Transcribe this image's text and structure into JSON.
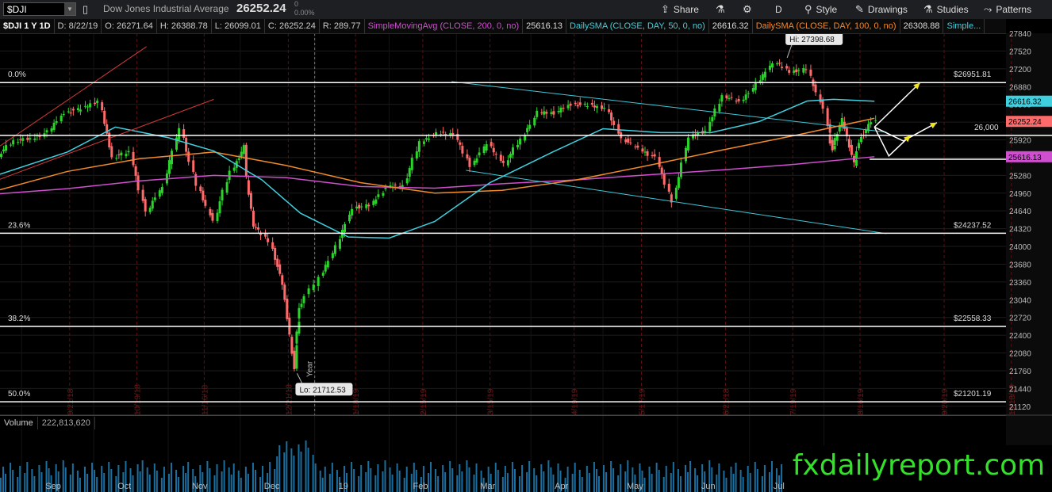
{
  "toolbar": {
    "symbol": "$DJI",
    "instrument_name": "Dow Jones Industrial Average",
    "last_price": "26252.24",
    "change": "0",
    "change_pct": "0.00%",
    "share_label": "Share",
    "interval_label": "D",
    "style_label": "Style",
    "drawings_label": "Drawings",
    "studies_label": "Studies",
    "patterns_label": "Patterns",
    "icons": [
      "flask-icon",
      "gear-icon",
      "style-icon",
      "drawings-icon",
      "studies-icon",
      "patterns-icon",
      "share-icon"
    ]
  },
  "infobar": {
    "symbol_period": "$DJI 1 Y 1D",
    "date": "D: 8/22/19",
    "open": "O: 26271.64",
    "high": "H: 26388.78",
    "low": "L: 26099.01",
    "close": "C: 26252.24",
    "range": "R: 289.77",
    "sma200_label": "SimpleMovingAvg (CLOSE, 200, 0, no)",
    "sma200_value": "25616.13",
    "sma50_label": "DailySMA (CLOSE, DAY, 50, 0, no)",
    "sma50_value": "26616.32",
    "sma100_label": "DailySMA (CLOSE, DAY, 100, 0, no)",
    "sma100_value": "26308.88",
    "more_label": "Simple..."
  },
  "volume": {
    "label": "Volume",
    "value": "222,813,620"
  },
  "watermark": "fxdailyreport.com",
  "colors": {
    "up": "#2bd42b",
    "down": "#ff6b6b",
    "sma200": "#d04fd0",
    "sma50": "#3fd0e0",
    "sma100": "#f08a2a",
    "trend_red": "#d33a3a",
    "trend_cyan": "#3fc8d8",
    "fib": "#ffffff",
    "volume": "#1b6fa0",
    "arrows": "#f2e41a"
  },
  "chart_data": {
    "type": "candlestick",
    "title": "$DJI 1 Y 1D",
    "ylim": [
      20960,
      27840
    ],
    "y_ticks": [
      21120,
      21440,
      21760,
      22080,
      22400,
      22720,
      23040,
      23360,
      23680,
      24000,
      24320,
      24640,
      24960,
      25280,
      25600,
      25920,
      26240,
      26560,
      26880,
      27200,
      27520,
      27840
    ],
    "y_tick_top_partial": "27840",
    "x_month_labels": [
      {
        "label": "Sep",
        "date": "2018-09-01"
      },
      {
        "label": "Oct",
        "date": "2018-10-01"
      },
      {
        "label": "Nov",
        "date": "2018-11-01"
      },
      {
        "label": "Dec",
        "date": "2018-12-01"
      },
      {
        "label": "19",
        "date": "2019-01-01"
      },
      {
        "label": "Feb",
        "date": "2019-02-01"
      },
      {
        "label": "Mar",
        "date": "2019-03-01"
      },
      {
        "label": "Apr",
        "date": "2019-04-01"
      },
      {
        "label": "May",
        "date": "2019-05-01"
      },
      {
        "label": "Jun",
        "date": "2019-06-01"
      },
      {
        "label": "Jul",
        "date": "2019-07-01"
      },
      {
        "label": "Au",
        "date": "2019-08-01"
      }
    ],
    "date_range": [
      "2018-08-23",
      "2019-09-20"
    ],
    "vertical_event_dates": [
      "9/21/18",
      "10/19/18",
      "11/16/18",
      "12/21/18",
      "1/18/19",
      "2/15/19",
      "3/15/19",
      "4/19/19",
      "5/17/19",
      "6/21/18",
      "7/19/19",
      "8/16/19",
      "9/20/19",
      "10/18/19"
    ],
    "vertical_event_positions": [
      "2018-09-21",
      "2018-10-19",
      "2018-11-16",
      "2018-12-21",
      "2019-01-18",
      "2019-02-15",
      "2019-03-15",
      "2019-04-19",
      "2019-05-17",
      "2019-06-21",
      "2019-07-19",
      "2019-08-16",
      "2019-09-20",
      "2019-10-18"
    ],
    "year_marker": {
      "date": "2019-01-01",
      "label": "Year"
    },
    "annotations": [
      {
        "text": "Hi: 27398.68",
        "date": "2019-07-16",
        "value": 27398.68
      },
      {
        "text": "Lo: 21712.53",
        "date": "2018-12-24",
        "value": 21712.53
      }
    ],
    "fib_levels": [
      {
        "label": "0.0%",
        "value": 26951.81,
        "price_label": "$26951.81"
      },
      {
        "label": "23.6%",
        "value": 24237.52,
        "price_label": "$24237.52"
      },
      {
        "label": "38.2%",
        "value": 22558.33,
        "price_label": "$22558.33"
      },
      {
        "label": "50.0%",
        "value": 21201.19,
        "price_label": "$21201.19"
      }
    ],
    "horizontal_lines": [
      {
        "label": "26,000",
        "value": 26000,
        "from": "2018-08-23",
        "to": "2019-09-20"
      },
      {
        "label": "",
        "value": 25570,
        "from": "2019-08-20",
        "to": "2019-09-20"
      }
    ],
    "price_tags": [
      {
        "value": 26616.32,
        "text": "26616.32",
        "color": "#3fd0e0"
      },
      {
        "value": 26252.24,
        "text": "26252.24",
        "color": "#ff6b6b"
      },
      {
        "value": 25616.13,
        "text": "25616.13",
        "color": "#d04fd0"
      }
    ],
    "trend_lines": [
      {
        "color": "red",
        "points": [
          [
            "2018-08-23",
            25810
          ],
          [
            "2018-10-23",
            27600
          ]
        ]
      },
      {
        "color": "red",
        "points": [
          [
            "2018-08-23",
            25210
          ],
          [
            "2018-11-20",
            26650
          ]
        ]
      },
      {
        "color": "cyan",
        "points": [
          [
            "2019-02-27",
            26970
          ],
          [
            "2019-08-27",
            26060
          ]
        ]
      },
      {
        "color": "cyan",
        "points": [
          [
            "2019-03-05",
            25370
          ],
          [
            "2019-08-27",
            24230
          ]
        ]
      }
    ],
    "arrow_paths": [
      {
        "color": "white",
        "points": [
          [
            "2019-08-22",
            26150
          ],
          [
            "2019-09-10",
            26950
          ]
        ]
      },
      {
        "color": "white",
        "points": [
          [
            "2019-08-22",
            26150
          ],
          [
            "2019-09-03",
            25900
          ],
          [
            "2019-09-17",
            26230
          ]
        ]
      },
      {
        "color": "white",
        "points": [
          [
            "2019-08-22",
            26150
          ],
          [
            "2019-08-28",
            25630
          ],
          [
            "2019-09-06",
            26000
          ]
        ]
      }
    ],
    "candles": [
      {
        "date": "2018-08-23",
        "close": 25655
      },
      {
        "date": "2018-08-30",
        "close": 25900
      },
      {
        "date": "2018-09-06",
        "close": 25930
      },
      {
        "date": "2018-09-13",
        "close": 26060
      },
      {
        "date": "2018-09-20",
        "close": 26410
      },
      {
        "date": "2018-09-27",
        "close": 26480
      },
      {
        "date": "2018-10-04",
        "close": 26630
      },
      {
        "date": "2018-10-10",
        "close": 25600
      },
      {
        "date": "2018-10-17",
        "close": 25700
      },
      {
        "date": "2018-10-24",
        "close": 24600
      },
      {
        "date": "2018-10-31",
        "close": 25100
      },
      {
        "date": "2018-11-07",
        "close": 26150
      },
      {
        "date": "2018-11-14",
        "close": 25100
      },
      {
        "date": "2018-11-21",
        "close": 24460
      },
      {
        "date": "2018-11-28",
        "close": 25350
      },
      {
        "date": "2018-12-03",
        "close": 25800
      },
      {
        "date": "2018-12-07",
        "close": 24390
      },
      {
        "date": "2018-12-14",
        "close": 24100
      },
      {
        "date": "2018-12-19",
        "close": 23320
      },
      {
        "date": "2018-12-24",
        "close": 21790
      },
      {
        "date": "2018-12-26",
        "close": 22880
      },
      {
        "date": "2019-01-04",
        "close": 23430
      },
      {
        "date": "2019-01-11",
        "close": 23990
      },
      {
        "date": "2019-01-18",
        "close": 24700
      },
      {
        "date": "2019-01-25",
        "close": 24740
      },
      {
        "date": "2019-02-01",
        "close": 25060
      },
      {
        "date": "2019-02-08",
        "close": 25100
      },
      {
        "date": "2019-02-15",
        "close": 25880
      },
      {
        "date": "2019-02-22",
        "close": 26030
      },
      {
        "date": "2019-03-01",
        "close": 26030
      },
      {
        "date": "2019-03-08",
        "close": 25450
      },
      {
        "date": "2019-03-15",
        "close": 25850
      },
      {
        "date": "2019-03-22",
        "close": 25500
      },
      {
        "date": "2019-03-29",
        "close": 25930
      },
      {
        "date": "2019-04-05",
        "close": 26420
      },
      {
        "date": "2019-04-12",
        "close": 26410
      },
      {
        "date": "2019-04-19",
        "close": 26560
      },
      {
        "date": "2019-04-26",
        "close": 26540
      },
      {
        "date": "2019-05-03",
        "close": 26500
      },
      {
        "date": "2019-05-10",
        "close": 25940
      },
      {
        "date": "2019-05-17",
        "close": 25760
      },
      {
        "date": "2019-05-24",
        "close": 25590
      },
      {
        "date": "2019-05-31",
        "close": 24820
      },
      {
        "date": "2019-06-07",
        "close": 25980
      },
      {
        "date": "2019-06-14",
        "close": 26090
      },
      {
        "date": "2019-06-21",
        "close": 26720
      },
      {
        "date": "2019-06-28",
        "close": 26600
      },
      {
        "date": "2019-07-05",
        "close": 26920
      },
      {
        "date": "2019-07-12",
        "close": 27330
      },
      {
        "date": "2019-07-19",
        "close": 27150
      },
      {
        "date": "2019-07-26",
        "close": 27190
      },
      {
        "date": "2019-08-02",
        "close": 26480
      },
      {
        "date": "2019-08-05",
        "close": 25720
      },
      {
        "date": "2019-08-09",
        "close": 26290
      },
      {
        "date": "2019-08-14",
        "close": 25480
      },
      {
        "date": "2019-08-16",
        "close": 25890
      },
      {
        "date": "2019-08-22",
        "close": 26252
      }
    ],
    "sma50": [
      {
        "date": "2018-08-23",
        "value": 25300
      },
      {
        "date": "2018-09-20",
        "value": 25700
      },
      {
        "date": "2018-10-10",
        "value": 26150
      },
      {
        "date": "2018-11-01",
        "value": 25960
      },
      {
        "date": "2018-11-20",
        "value": 25720
      },
      {
        "date": "2018-12-10",
        "value": 25200
      },
      {
        "date": "2018-12-26",
        "value": 24600
      },
      {
        "date": "2019-01-15",
        "value": 24170
      },
      {
        "date": "2019-02-01",
        "value": 24150
      },
      {
        "date": "2019-02-20",
        "value": 24450
      },
      {
        "date": "2019-03-15",
        "value": 25150
      },
      {
        "date": "2019-04-10",
        "value": 25700
      },
      {
        "date": "2019-05-01",
        "value": 26120
      },
      {
        "date": "2019-05-25",
        "value": 26050
      },
      {
        "date": "2019-06-15",
        "value": 26050
      },
      {
        "date": "2019-07-05",
        "value": 26250
      },
      {
        "date": "2019-07-25",
        "value": 26620
      },
      {
        "date": "2019-08-05",
        "value": 26650
      },
      {
        "date": "2019-08-22",
        "value": 26616
      }
    ],
    "sma100": [
      {
        "date": "2018-08-23",
        "value": 25020
      },
      {
        "date": "2018-09-20",
        "value": 25350
      },
      {
        "date": "2018-10-20",
        "value": 25580
      },
      {
        "date": "2018-11-20",
        "value": 25700
      },
      {
        "date": "2018-12-20",
        "value": 25460
      },
      {
        "date": "2019-01-20",
        "value": 25150
      },
      {
        "date": "2019-02-20",
        "value": 24960
      },
      {
        "date": "2019-03-20",
        "value": 25010
      },
      {
        "date": "2019-04-20",
        "value": 25200
      },
      {
        "date": "2019-05-20",
        "value": 25460
      },
      {
        "date": "2019-06-20",
        "value": 25740
      },
      {
        "date": "2019-07-20",
        "value": 26000
      },
      {
        "date": "2019-08-22",
        "value": 26309
      }
    ],
    "sma200": [
      {
        "date": "2018-08-23",
        "value": 24950
      },
      {
        "date": "2018-09-20",
        "value": 25040
      },
      {
        "date": "2018-10-20",
        "value": 25180
      },
      {
        "date": "2018-11-20",
        "value": 25280
      },
      {
        "date": "2018-12-20",
        "value": 25240
      },
      {
        "date": "2019-01-20",
        "value": 25080
      },
      {
        "date": "2019-02-20",
        "value": 25050
      },
      {
        "date": "2019-03-20",
        "value": 25130
      },
      {
        "date": "2019-04-20",
        "value": 25200
      },
      {
        "date": "2019-05-20",
        "value": 25290
      },
      {
        "date": "2019-06-20",
        "value": 25380
      },
      {
        "date": "2019-07-20",
        "value": 25480
      },
      {
        "date": "2019-08-22",
        "value": 25616
      }
    ],
    "volume_ylim": [
      0,
      1600000000
    ]
  }
}
